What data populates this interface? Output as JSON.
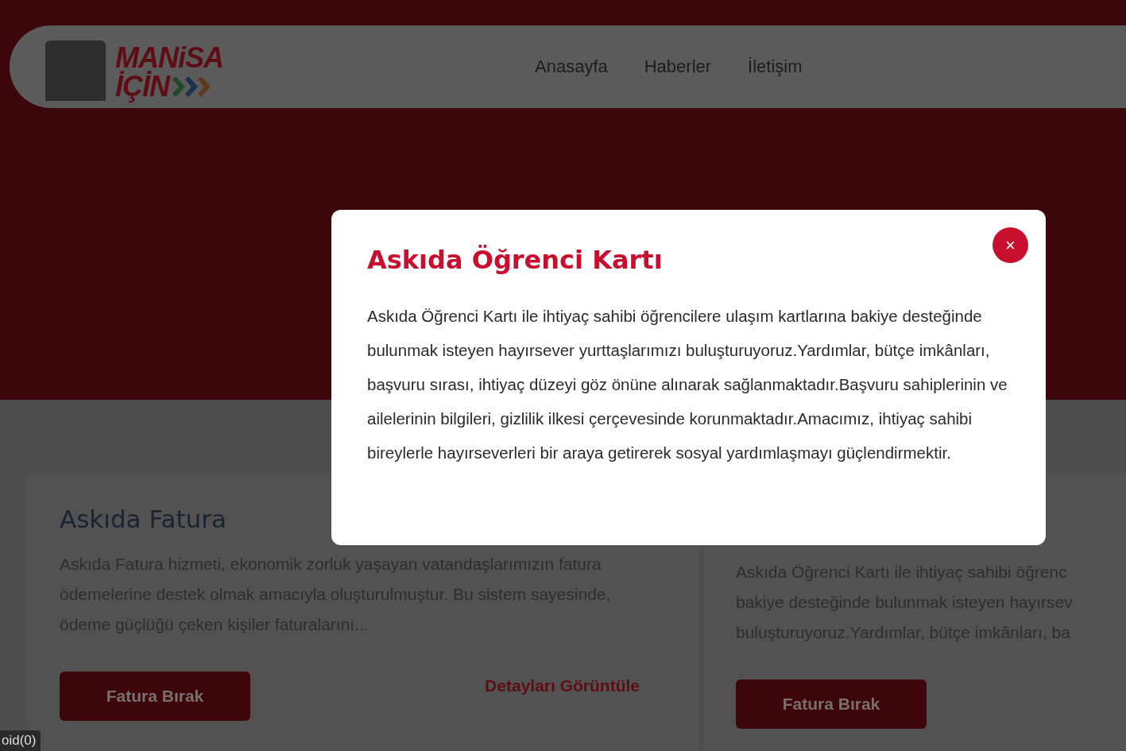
{
  "header": {
    "logo": {
      "line_1": "MANiSA",
      "line_2": "İÇİN"
    },
    "nav": [
      {
        "label": "Anasayfa"
      },
      {
        "label": "Haberler"
      },
      {
        "label": "İletişim"
      }
    ]
  },
  "cards": [
    {
      "title": "Askıda Fatura",
      "description": "Askıda Fatura hizmeti, ekonomik zorluk yaşayan vatandaşlarımızın fatura ödemelerine destek olmak amacıyla oluşturulmuştur. Bu sistem sayesinde, ödeme güçlüğü çeken kişiler faturalarını...",
      "button": "Fatura Bırak",
      "link": "Detayları Görüntüle"
    },
    {
      "description_lines": [
        "Askıda Öğrenci Kartı ile ihtiyaç sahibi öğrenc",
        "bakiye desteğinde bulunmak isteyen hayırsev",
        "buluşturuyoruz.Yardımlar, bütçe imkânları, ba"
      ],
      "button": "Fatura Bırak"
    }
  ],
  "modal": {
    "title": "Askıda Öğrenci Kartı",
    "close": "×",
    "body": "Askıda Öğrenci Kartı ile ihtiyaç sahibi öğrencilere ulaşım kartlarına bakiye desteğinde bulunmak isteyen hayırsever yurttaşlarımızı buluşturuyoruz.Yardımlar, bütçe imkânları, başvuru sırası, ihtiyaç düzeyi göz önüne alınarak sağlanmaktadır.Başvuru sahiplerinin ve ailelerinin bilgileri, gizlilik ilkesi çerçevesinde korunmaktadır.Amacımız, ihtiyaç sahibi bireylerle hayırseverleri bir araya getirerek sosyal yardımlaşmayı güçlendirmektir."
  },
  "status_url": "oid(0)"
}
